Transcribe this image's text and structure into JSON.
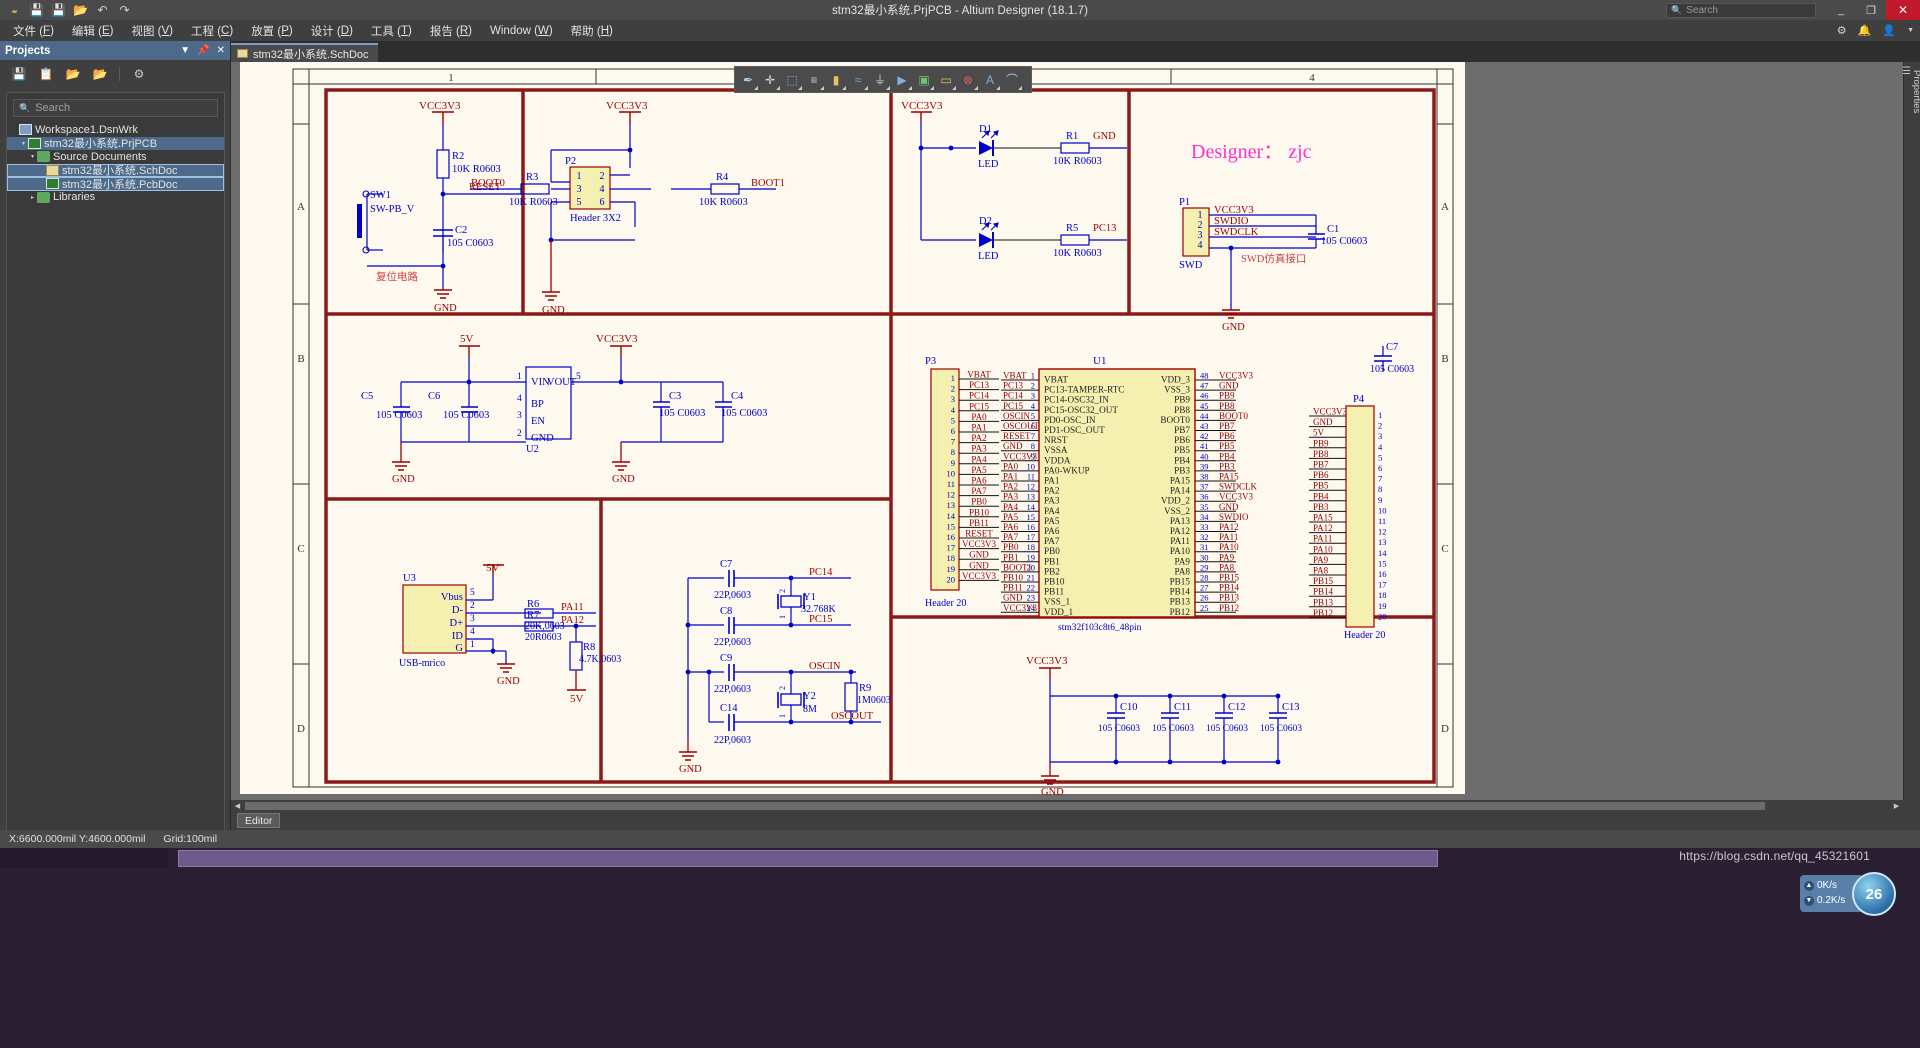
{
  "window": {
    "title": "stm32最小系统.PrjPCB - Altium Designer (18.1.7)",
    "quick_icons": [
      "altium-logo-icon",
      "save-icon",
      "save-all-icon",
      "open-folder-icon",
      "undo-icon",
      "redo-icon"
    ],
    "search_placeholder": "Search",
    "minimize_label": "_",
    "restore_label": "❐",
    "close_label": "✕"
  },
  "menu": {
    "items": [
      {
        "label": "文件",
        "key": "F"
      },
      {
        "label": "编辑",
        "key": "E"
      },
      {
        "label": "视图",
        "key": "V"
      },
      {
        "label": "工程",
        "key": "C"
      },
      {
        "label": "放置",
        "key": "P"
      },
      {
        "label": "设计",
        "key": "D"
      },
      {
        "label": "工具",
        "key": "T"
      },
      {
        "label": "报告",
        "key": "R"
      },
      {
        "label": "Window",
        "key": "W"
      },
      {
        "label": "帮助",
        "key": "H"
      }
    ],
    "right_icons": [
      "gear-icon",
      "bell-icon",
      "user-icon",
      "chevron-down-icon"
    ]
  },
  "projects_panel": {
    "title": "Projects",
    "header_buttons": [
      "chevron-down-icon",
      "pin-icon",
      "close-icon"
    ],
    "toolbar_icons": [
      "save-icon",
      "copy-icon",
      "open-project-icon",
      "close-project-icon",
      "settings-icon"
    ],
    "search_placeholder": "Search",
    "tree": [
      {
        "label": "Workspace1.DsnWrk",
        "indent": 0,
        "icon": "workspace-icon",
        "arrow": "",
        "selected": false
      },
      {
        "label": "stm32最小系统.PrjPCB",
        "indent": 1,
        "icon": "project-icon",
        "arrow": "▾",
        "selected": true
      },
      {
        "label": "Source Documents",
        "indent": 2,
        "icon": "folder-icon",
        "arrow": "▾",
        "selected": false
      },
      {
        "label": "stm32最小系统.SchDoc",
        "indent": 3,
        "icon": "schdoc-icon",
        "arrow": "",
        "selected": true
      },
      {
        "label": "stm32最小系统.PcbDoc",
        "indent": 3,
        "icon": "pcbdoc-icon",
        "arrow": "",
        "selected": true
      },
      {
        "label": "Libraries",
        "indent": 2,
        "icon": "folder-icon",
        "arrow": "▸",
        "selected": false
      }
    ]
  },
  "document_tab": {
    "label": "stm32最小系统.SchDoc"
  },
  "properties_rail": {
    "label": "Properties"
  },
  "floating_toolbar": {
    "icons": [
      "filter-icon",
      "crosshair-icon",
      "select-region-icon",
      "align-icon",
      "component-icon",
      "wire-icon",
      "ground-icon",
      "port-icon",
      "sheet-symbol-icon",
      "net-label-icon",
      "no-erc-icon",
      "text-icon",
      "arc-icon"
    ]
  },
  "editor": {
    "column_labels": [
      "1",
      "4"
    ],
    "row_labels_left": [
      "A",
      "B",
      "C",
      "D"
    ],
    "row_labels_right": [
      "A",
      "B",
      "C",
      "D"
    ]
  },
  "schematic": {
    "annotations": [
      {
        "text": "复位电路",
        "color": "#d04040"
      },
      {
        "text": "Designer：  zjc",
        "color": "#ff2fd0"
      },
      {
        "text": "SWD仿真接口",
        "color": "#d04040"
      }
    ],
    "reset_circuit": {
      "vcc": "VCC3V3",
      "r2": {
        "ref": "R2",
        "value": "10K R0603"
      },
      "net_reset": "RESET",
      "sw1": {
        "ref": "SW1",
        "value": "SW-PB_V"
      },
      "c2": {
        "ref": "C2",
        "value": "105 C0603"
      },
      "gnd": "GND",
      "note": "复位电路"
    },
    "boot_circuit": {
      "vcc": "VCC3V3",
      "p2": {
        "ref": "P2",
        "value": "Header 3X2",
        "pins": [
          "1",
          "2",
          "3",
          "4",
          "5",
          "6"
        ]
      },
      "r3": {
        "ref": "R3",
        "value": "10K R0603"
      },
      "r4": {
        "ref": "R4",
        "value": "10K R0603"
      },
      "net_boot0": "BOOT0",
      "net_boot1": "BOOT1",
      "gnd": "GND"
    },
    "led_circuit": {
      "vcc": "VCC3V3",
      "d1": {
        "ref": "D1",
        "value": "LED"
      },
      "d2": {
        "ref": "D2",
        "value": "LED"
      },
      "r1": {
        "ref": "R1",
        "value": "10K R0603"
      },
      "r5": {
        "ref": "R5",
        "value": "10K R0603"
      },
      "net_gnd": "GND",
      "net_pc13": "PC13"
    },
    "swd_circuit": {
      "title": "Designer：  zjc",
      "p1": {
        "ref": "P1",
        "value": "SWD",
        "pins": [
          "1",
          "2",
          "3",
          "4"
        ]
      },
      "nets": [
        "VCC3V3",
        "SWDIO",
        "SWDCLK"
      ],
      "c1": {
        "ref": "C1",
        "value": "105 C0603"
      },
      "gnd": "GND",
      "note": "SWD仿真接口"
    },
    "power_circuit": {
      "in": "5V",
      "out": "VCC3V3",
      "u2": {
        "ref": "U2",
        "pins_left": [
          {
            "n": "1",
            "name": "VIN"
          },
          {
            "n": "4",
            "name": "BP"
          },
          {
            "n": "3",
            "name": "EN"
          },
          {
            "n": "2",
            "name": "GND"
          }
        ],
        "pins_right": [
          {
            "n": "5",
            "name": "VOUT"
          }
        ]
      },
      "c5": {
        "ref": "C5",
        "value": "105 C0603"
      },
      "c6": {
        "ref": "C6",
        "value": "105 C0603"
      },
      "c3": {
        "ref": "C3",
        "value": "105 C0603"
      },
      "c4": {
        "ref": "C4",
        "value": "105 C0603"
      },
      "gnd": "GND"
    },
    "usb_circuit": {
      "u3": {
        "ref": "U3",
        "value": "USB-mrico",
        "pins": [
          {
            "n": "5",
            "name": "Vbus"
          },
          {
            "n": "2",
            "name": "D-"
          },
          {
            "n": "3",
            "name": "D+"
          },
          {
            "n": "4",
            "name": "ID"
          },
          {
            "n": "1",
            "name": "G"
          }
        ]
      },
      "r6": {
        "ref": "R6",
        "value": "20K,0603"
      },
      "r7": {
        "ref": "R7",
        "value": "20R0603"
      },
      "r8": {
        "ref": "R8",
        "value": "4.7K,0603"
      },
      "nets": [
        "5V",
        "PA11",
        "PA12",
        "GND"
      ]
    },
    "crystal_circuit": {
      "c7": {
        "ref": "C7",
        "value": "22P,0603"
      },
      "c8": {
        "ref": "C8",
        "value": "22P,0603"
      },
      "c9": {
        "ref": "C9",
        "value": "22P,0603"
      },
      "c14": {
        "ref": "C14",
        "value": "22P,0603"
      },
      "y1": {
        "ref": "Y1",
        "value": "32.768K",
        "pins": [
          "1",
          "2"
        ]
      },
      "y2": {
        "ref": "Y2",
        "value": "8M",
        "pins": [
          "1",
          "2"
        ]
      },
      "r9": {
        "ref": "R9",
        "value": "1M0603"
      },
      "nets": [
        "PC14",
        "PC15",
        "OSCIN",
        "OSCOUT",
        "GND"
      ]
    },
    "decoupling_circuit": {
      "vcc": "VCC3V3",
      "caps": [
        {
          "ref": "C10",
          "value": "105 C0603"
        },
        {
          "ref": "C11",
          "value": "105 C0603"
        },
        {
          "ref": "C12",
          "value": "105 C0603"
        },
        {
          "ref": "C13",
          "value": "105 C0603"
        }
      ],
      "gnd": "GND"
    },
    "header_p3": {
      "ref": "P3",
      "value": "Header 20",
      "rows": [
        {
          "pin": "1",
          "net": "VBAT"
        },
        {
          "pin": "2",
          "net": "PC13"
        },
        {
          "pin": "3",
          "net": "PC14"
        },
        {
          "pin": "4",
          "net": "PC15"
        },
        {
          "pin": "5",
          "net": "PA0"
        },
        {
          "pin": "6",
          "net": "PA1"
        },
        {
          "pin": "7",
          "net": "PA2"
        },
        {
          "pin": "8",
          "net": "PA3"
        },
        {
          "pin": "9",
          "net": "PA4"
        },
        {
          "pin": "10",
          "net": "PA5"
        },
        {
          "pin": "11",
          "net": "PA6"
        },
        {
          "pin": "12",
          "net": "PA7"
        },
        {
          "pin": "13",
          "net": "PB0"
        },
        {
          "pin": "14",
          "net": "PB10"
        },
        {
          "pin": "15",
          "net": "PB11"
        },
        {
          "pin": "16",
          "net": "RESET"
        },
        {
          "pin": "17",
          "net": "VCC3V3"
        },
        {
          "pin": "18",
          "net": "GND"
        },
        {
          "pin": "19",
          "net": "GND"
        },
        {
          "pin": "20",
          "net": "VCC3V3"
        }
      ]
    },
    "header_p4": {
      "ref": "P4",
      "value": "Header 20",
      "rows": [
        {
          "pin": "1",
          "net": "VCC3V3"
        },
        {
          "pin": "2",
          "net": "GND"
        },
        {
          "pin": "3",
          "net": "5V"
        },
        {
          "pin": "4",
          "net": "PB9"
        },
        {
          "pin": "5",
          "net": "PB8"
        },
        {
          "pin": "6",
          "net": "PB7"
        },
        {
          "pin": "7",
          "net": "PB6"
        },
        {
          "pin": "8",
          "net": "PB5"
        },
        {
          "pin": "9",
          "net": "PB4"
        },
        {
          "pin": "10",
          "net": "PB3"
        },
        {
          "pin": "11",
          "net": "PA15"
        },
        {
          "pin": "12",
          "net": "PA12"
        },
        {
          "pin": "13",
          "net": "PA11"
        },
        {
          "pin": "14",
          "net": "PA10"
        },
        {
          "pin": "15",
          "net": "PA9"
        },
        {
          "pin": "16",
          "net": "PA8"
        },
        {
          "pin": "17",
          "net": "PB15"
        },
        {
          "pin": "18",
          "net": "PB14"
        },
        {
          "pin": "19",
          "net": "PB13"
        },
        {
          "pin": "20",
          "net": "PB12"
        }
      ]
    },
    "mcu": {
      "ref": "U1",
      "value": "stm32f103c8t6_48pin",
      "left_pins": [
        {
          "n": "1",
          "name": "VBAT",
          "net": "VBAT"
        },
        {
          "n": "2",
          "name": "PC13-TAMPER-RTC",
          "net": "PC13"
        },
        {
          "n": "3",
          "name": "PC14-OSC32_IN",
          "net": "PC14"
        },
        {
          "n": "4",
          "name": "PC15-OSC32_OUT",
          "net": "PC15"
        },
        {
          "n": "5",
          "name": "PD0-OSC_IN",
          "net": "OSCIN"
        },
        {
          "n": "6",
          "name": "PD1-OSC_OUT",
          "net": "OSCOUT"
        },
        {
          "n": "7",
          "name": "NRST",
          "net": "RESET"
        },
        {
          "n": "8",
          "name": "VSSA",
          "net": "GND"
        },
        {
          "n": "9",
          "name": "VDDA",
          "net": "VCC3V3"
        },
        {
          "n": "10",
          "name": "PA0-WKUP",
          "net": "PA0"
        },
        {
          "n": "11",
          "name": "PA1",
          "net": "PA1"
        },
        {
          "n": "12",
          "name": "PA2",
          "net": "PA2"
        },
        {
          "n": "13",
          "name": "PA3",
          "net": "PA3"
        },
        {
          "n": "14",
          "name": "PA4",
          "net": "PA4"
        },
        {
          "n": "15",
          "name": "PA5",
          "net": "PA5"
        },
        {
          "n": "16",
          "name": "PA6",
          "net": "PA6"
        },
        {
          "n": "17",
          "name": "PA7",
          "net": "PA7"
        },
        {
          "n": "18",
          "name": "PB0",
          "net": "PB0"
        },
        {
          "n": "19",
          "name": "PB1",
          "net": "PB1"
        },
        {
          "n": "20",
          "name": "PB2",
          "net": "BOOT1"
        },
        {
          "n": "21",
          "name": "PB10",
          "net": "PB10"
        },
        {
          "n": "22",
          "name": "PB11",
          "net": "PB11"
        },
        {
          "n": "23",
          "name": "VSS_1",
          "net": "GND"
        },
        {
          "n": "24",
          "name": "VDD_1",
          "net": "VCC3V3"
        }
      ],
      "right_pins": [
        {
          "n": "48",
          "name": "VDD_3",
          "net": "VCC3V3"
        },
        {
          "n": "47",
          "name": "VSS_3",
          "net": "GND"
        },
        {
          "n": "46",
          "name": "PB9",
          "net": "PB9"
        },
        {
          "n": "45",
          "name": "PB8",
          "net": "PB8"
        },
        {
          "n": "44",
          "name": "BOOT0",
          "net": "BOOT0"
        },
        {
          "n": "43",
          "name": "PB7",
          "net": "PB7"
        },
        {
          "n": "42",
          "name": "PB6",
          "net": "PB6"
        },
        {
          "n": "41",
          "name": "PB5",
          "net": "PB5"
        },
        {
          "n": "40",
          "name": "PB4",
          "net": "PB4"
        },
        {
          "n": "39",
          "name": "PB3",
          "net": "PB3"
        },
        {
          "n": "38",
          "name": "PA15",
          "net": "PA15"
        },
        {
          "n": "37",
          "name": "PA14",
          "net": "SWDCLK"
        },
        {
          "n": "36",
          "name": "VDD_2",
          "net": "VCC3V3"
        },
        {
          "n": "35",
          "name": "VSS_2",
          "net": "GND"
        },
        {
          "n": "34",
          "name": "PA13",
          "net": "SWDIO"
        },
        {
          "n": "33",
          "name": "PA12",
          "net": "PA12"
        },
        {
          "n": "32",
          "name": "PA11",
          "net": "PA11"
        },
        {
          "n": "31",
          "name": "PA10",
          "net": "PA10"
        },
        {
          "n": "30",
          "name": "PA9",
          "net": "PA9"
        },
        {
          "n": "29",
          "name": "PA8",
          "net": "PA8"
        },
        {
          "n": "28",
          "name": "PB15",
          "net": "PB15"
        },
        {
          "n": "27",
          "name": "PB14",
          "net": "PB14"
        },
        {
          "n": "26",
          "name": "PB13",
          "net": "PB13"
        },
        {
          "n": "25",
          "name": "PB12",
          "net": "PB12"
        }
      ]
    },
    "c7_top": {
      "ref": "C7",
      "value": "105 C0603"
    }
  },
  "panel_tabs": {
    "editor": "Editor"
  },
  "status_bar": {
    "coords": "X:6600.000mil Y:4600.000mil",
    "grid": "Grid:100mil"
  },
  "taskbar": {
    "watermark": "https://blog.csdn.net/qq_45321601",
    "net_up": "0K/s",
    "net_down": "0.2K/s",
    "net_badge": "26"
  },
  "colors": {
    "accent": "#4d6a8a",
    "sheet_bg": "#fdf9ef",
    "wire_blue": "#0000c8",
    "net_red": "#9b0000",
    "frame_red": "#8b1a1a",
    "comp_yellow": "#f6f0b0",
    "designer_pink": "#ff2fd0",
    "close_red": "#c0192b"
  }
}
